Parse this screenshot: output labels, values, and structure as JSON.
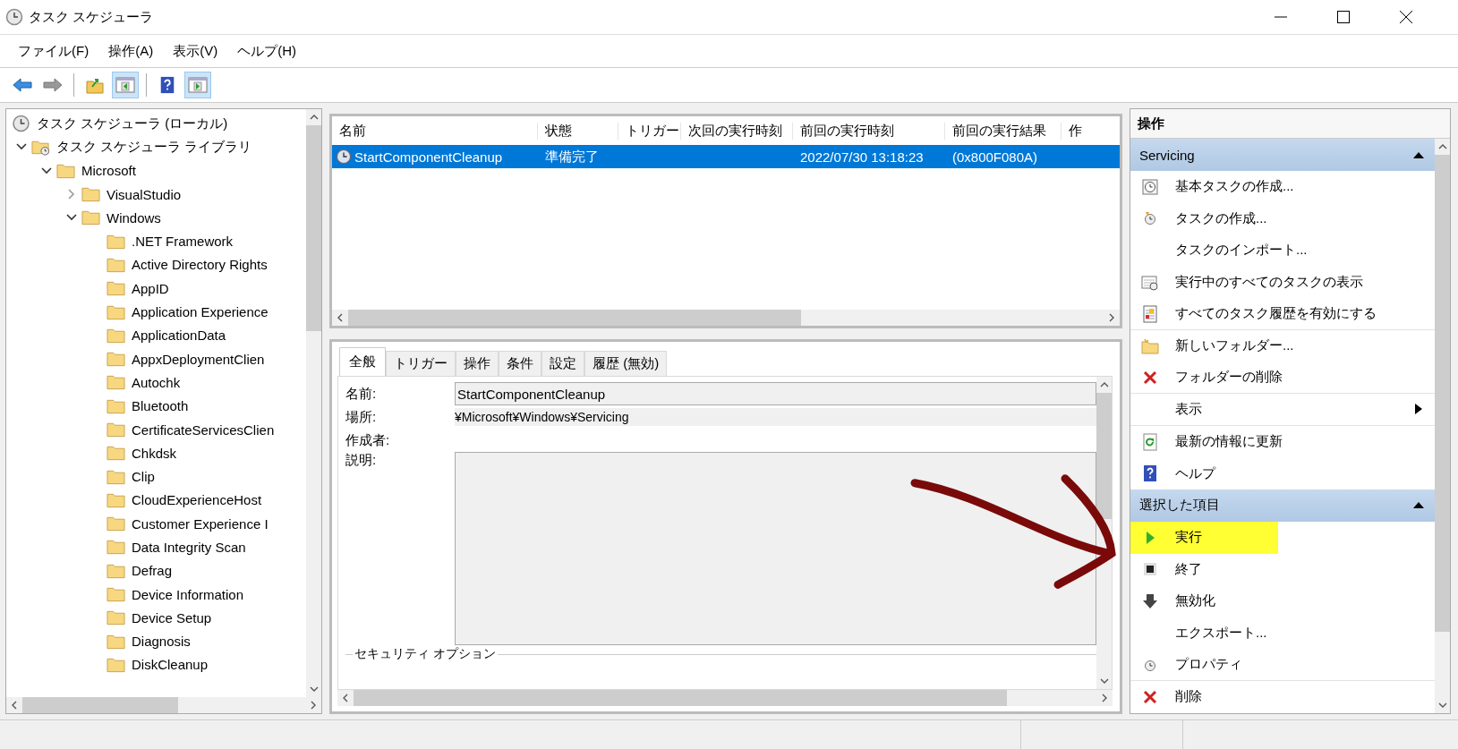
{
  "window": {
    "title": "タスク スケジューラ"
  },
  "menu": [
    "ファイル(F)",
    "操作(A)",
    "表示(V)",
    "ヘルプ(H)"
  ],
  "toolbar": [
    [
      {
        "kind": "back",
        "pressed": false
      },
      {
        "kind": "forward",
        "pressed": false
      }
    ],
    [
      {
        "kind": "up",
        "pressed": false
      },
      {
        "kind": "tree-pane",
        "pressed": true
      }
    ],
    [
      {
        "kind": "help",
        "pressed": false
      },
      {
        "kind": "action-pane",
        "pressed": true
      }
    ]
  ],
  "tree": [
    {
      "label": "タスク スケジューラ (ローカル)",
      "kind": "root",
      "children": [
        {
          "label": "タスク スケジューラ ライブラリ",
          "kind": "library",
          "expanded": true,
          "children": [
            {
              "label": "Microsoft",
              "kind": "folder",
              "expanded": true,
              "children": [
                {
                  "label": "VisualStudio",
                  "kind": "folder",
                  "expanded": false
                },
                {
                  "label": "Windows",
                  "kind": "folder",
                  "expanded": true,
                  "children": [
                    {
                      "label": ".NET Framework",
                      "kind": "folder"
                    },
                    {
                      "label": "Active Directory Rights",
                      "kind": "folder"
                    },
                    {
                      "label": "AppID",
                      "kind": "folder"
                    },
                    {
                      "label": "Application Experience",
                      "kind": "folder"
                    },
                    {
                      "label": "ApplicationData",
                      "kind": "folder"
                    },
                    {
                      "label": "AppxDeploymentClien",
                      "kind": "folder"
                    },
                    {
                      "label": "Autochk",
                      "kind": "folder"
                    },
                    {
                      "label": "Bluetooth",
                      "kind": "folder"
                    },
                    {
                      "label": "CertificateServicesClien",
                      "kind": "folder"
                    },
                    {
                      "label": "Chkdsk",
                      "kind": "folder"
                    },
                    {
                      "label": "Clip",
                      "kind": "folder"
                    },
                    {
                      "label": "CloudExperienceHost",
                      "kind": "folder"
                    },
                    {
                      "label": "Customer Experience I",
                      "kind": "folder"
                    },
                    {
                      "label": "Data Integrity Scan",
                      "kind": "folder"
                    },
                    {
                      "label": "Defrag",
                      "kind": "folder"
                    },
                    {
                      "label": "Device Information",
                      "kind": "folder"
                    },
                    {
                      "label": "Device Setup",
                      "kind": "folder"
                    },
                    {
                      "label": "Diagnosis",
                      "kind": "folder"
                    },
                    {
                      "label": "DiskCleanup",
                      "kind": "folder"
                    }
                  ]
                }
              ]
            }
          ]
        }
      ]
    }
  ],
  "task_list": {
    "columns": [
      "名前",
      "状態",
      "トリガー",
      "次回の実行時刻",
      "前回の実行時刻",
      "前回の実行結果",
      "作"
    ],
    "rows": [
      {
        "cells": [
          "StartComponentCleanup",
          "準備完了",
          "",
          "",
          "2022/07/30 13:18:23",
          "(0x800F080A)",
          ""
        ],
        "selected": true
      }
    ]
  },
  "details": {
    "tabs": [
      {
        "label": "全般",
        "selected": true
      },
      {
        "label": "トリガー",
        "selected": false
      },
      {
        "label": "操作",
        "selected": false
      },
      {
        "label": "条件",
        "selected": false
      },
      {
        "label": "設定",
        "selected": false
      },
      {
        "label": "履歴 (無効)",
        "selected": false
      }
    ],
    "name_label": "名前:",
    "name_value": "StartComponentCleanup",
    "location_label": "場所:",
    "location_value": "¥Microsoft¥Windows¥Servicing",
    "author_label": "作成者:",
    "description_label": "説明:",
    "security_group": "セキュリティ オプション"
  },
  "actions": {
    "title": "操作",
    "sections": [
      {
        "title": "Servicing",
        "expanded": true,
        "items": [
          {
            "label": "基本タスクの作成...",
            "kind": "create-basic",
            "submenu": false,
            "highlighted": false,
            "separator_after": false
          },
          {
            "label": "タスクの作成...",
            "kind": "create",
            "submenu": false,
            "highlighted": false,
            "separator_after": false
          },
          {
            "label": "タスクのインポート...",
            "kind": "none",
            "submenu": false,
            "highlighted": false,
            "separator_after": false
          },
          {
            "label": "実行中のすべてのタスクの表示",
            "kind": "running",
            "submenu": false,
            "highlighted": false,
            "separator_after": false
          },
          {
            "label": "すべてのタスク履歴を有効にする",
            "kind": "history",
            "submenu": false,
            "highlighted": false,
            "separator_after": true
          },
          {
            "label": "新しいフォルダー...",
            "kind": "new-folder",
            "submenu": false,
            "highlighted": false,
            "separator_after": false
          },
          {
            "label": "フォルダーの削除",
            "kind": "delete",
            "submenu": false,
            "highlighted": false,
            "separator_after": true
          },
          {
            "label": "表示",
            "kind": "none",
            "submenu": true,
            "highlighted": false,
            "separator_after": true
          },
          {
            "label": "最新の情報に更新",
            "kind": "refresh",
            "submenu": false,
            "highlighted": false,
            "separator_after": false
          },
          {
            "label": "ヘルプ",
            "kind": "help",
            "submenu": false,
            "highlighted": false,
            "separator_after": false
          }
        ]
      },
      {
        "title": "選択した項目",
        "expanded": true,
        "items": [
          {
            "label": "実行",
            "kind": "run",
            "submenu": false,
            "highlighted": true,
            "separator_after": false
          },
          {
            "label": "終了",
            "kind": "end",
            "submenu": false,
            "highlighted": false,
            "separator_after": false
          },
          {
            "label": "無効化",
            "kind": "disable",
            "submenu": false,
            "highlighted": false,
            "separator_after": false
          },
          {
            "label": "エクスポート...",
            "kind": "none",
            "submenu": false,
            "highlighted": false,
            "separator_after": false
          },
          {
            "label": "プロパティ",
            "kind": "properties",
            "submenu": false,
            "highlighted": false,
            "separator_after": true
          },
          {
            "label": "削除",
            "kind": "delete",
            "submenu": false,
            "highlighted": false,
            "separator_after": false
          }
        ]
      }
    ]
  }
}
